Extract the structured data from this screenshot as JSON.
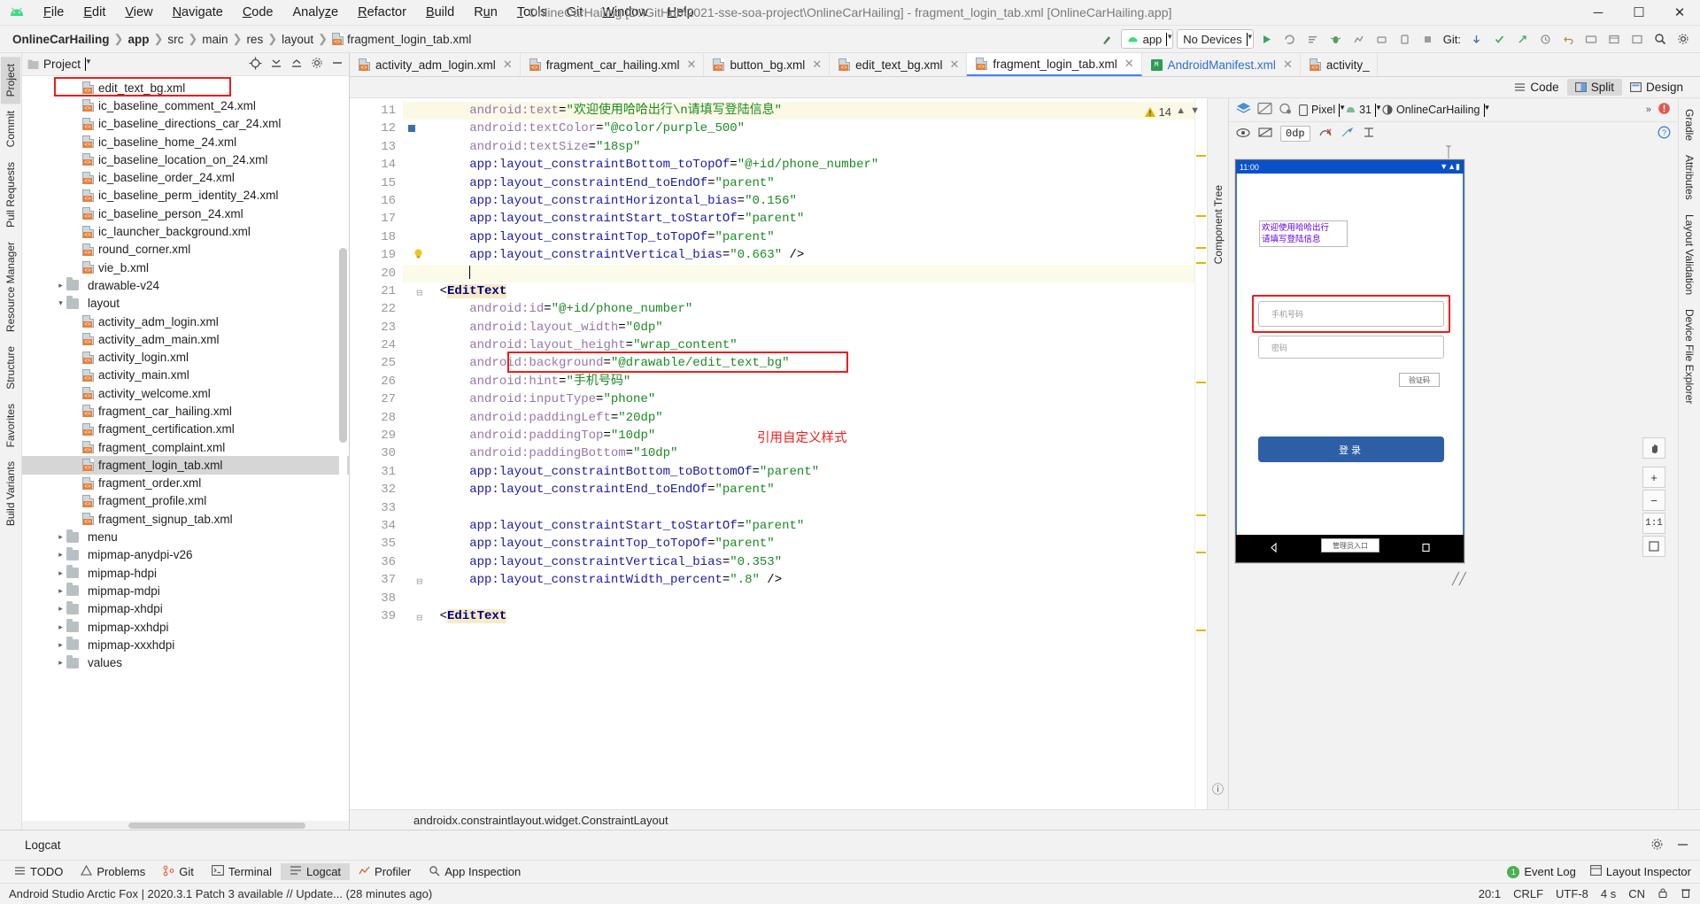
{
  "window": {
    "title": "OnlineCarHailing [D:\\GitHub\\2021-sse-soa-project\\OnlineCarHailing] - fragment_login_tab.xml [OnlineCarHailing.app]",
    "minimize": "—",
    "maximize": "❐",
    "close": "✕"
  },
  "menu": [
    "File",
    "Edit",
    "View",
    "Navigate",
    "Code",
    "Analyze",
    "Refactor",
    "Build",
    "Run",
    "Tools",
    "Git",
    "Window",
    "Help"
  ],
  "breadcrumb": [
    "OnlineCarHailing",
    "app",
    "src",
    "main",
    "res",
    "layout",
    "fragment_login_tab.xml"
  ],
  "toolbar": {
    "module_selector": "app",
    "device_selector": "No Devices",
    "git_label": "Git:"
  },
  "project_panel": {
    "title": "Project",
    "tree": [
      {
        "label": "edit_text_bg.xml",
        "type": "file",
        "indent": 3,
        "highlight": true
      },
      {
        "label": "ic_baseline_comment_24.xml",
        "type": "file",
        "indent": 3
      },
      {
        "label": "ic_baseline_directions_car_24.xml",
        "type": "file",
        "indent": 3
      },
      {
        "label": "ic_baseline_home_24.xml",
        "type": "file",
        "indent": 3
      },
      {
        "label": "ic_baseline_location_on_24.xml",
        "type": "file",
        "indent": 3
      },
      {
        "label": "ic_baseline_order_24.xml",
        "type": "file",
        "indent": 3
      },
      {
        "label": "ic_baseline_perm_identity_24.xml",
        "type": "file",
        "indent": 3
      },
      {
        "label": "ic_baseline_person_24.xml",
        "type": "file",
        "indent": 3
      },
      {
        "label": "ic_launcher_background.xml",
        "type": "file",
        "indent": 3
      },
      {
        "label": "round_corner.xml",
        "type": "file",
        "indent": 3
      },
      {
        "label": "vie_b.xml",
        "type": "file",
        "indent": 3
      },
      {
        "label": "drawable-v24",
        "type": "folder",
        "indent": 2,
        "arrow": "collapsed"
      },
      {
        "label": "layout",
        "type": "folder",
        "indent": 2,
        "arrow": "expanded"
      },
      {
        "label": "activity_adm_login.xml",
        "type": "file",
        "indent": 3
      },
      {
        "label": "activity_adm_main.xml",
        "type": "file",
        "indent": 3
      },
      {
        "label": "activity_login.xml",
        "type": "file",
        "indent": 3
      },
      {
        "label": "activity_main.xml",
        "type": "file",
        "indent": 3
      },
      {
        "label": "activity_welcome.xml",
        "type": "file",
        "indent": 3
      },
      {
        "label": "fragment_car_hailing.xml",
        "type": "file",
        "indent": 3
      },
      {
        "label": "fragment_certification.xml",
        "type": "file",
        "indent": 3
      },
      {
        "label": "fragment_complaint.xml",
        "type": "file",
        "indent": 3
      },
      {
        "label": "fragment_login_tab.xml",
        "type": "file",
        "indent": 3,
        "selected": true
      },
      {
        "label": "fragment_order.xml",
        "type": "file",
        "indent": 3
      },
      {
        "label": "fragment_profile.xml",
        "type": "file",
        "indent": 3
      },
      {
        "label": "fragment_signup_tab.xml",
        "type": "file",
        "indent": 3
      },
      {
        "label": "menu",
        "type": "folder",
        "indent": 2,
        "arrow": "collapsed"
      },
      {
        "label": "mipmap-anydpi-v26",
        "type": "folder",
        "indent": 2,
        "arrow": "collapsed"
      },
      {
        "label": "mipmap-hdpi",
        "type": "folder",
        "indent": 2,
        "arrow": "collapsed"
      },
      {
        "label": "mipmap-mdpi",
        "type": "folder",
        "indent": 2,
        "arrow": "collapsed"
      },
      {
        "label": "mipmap-xhdpi",
        "type": "folder",
        "indent": 2,
        "arrow": "collapsed"
      },
      {
        "label": "mipmap-xxhdpi",
        "type": "folder",
        "indent": 2,
        "arrow": "collapsed"
      },
      {
        "label": "mipmap-xxxhdpi",
        "type": "folder",
        "indent": 2,
        "arrow": "collapsed"
      },
      {
        "label": "values",
        "type": "folder",
        "indent": 2,
        "arrow": "collapsed"
      }
    ]
  },
  "left_rail": [
    "Project",
    "Commit",
    "Pull Requests",
    "Resource Manager",
    "Structure",
    "Favorites",
    "Build Variants"
  ],
  "right_rail": [
    "Gradle",
    "Attributes",
    "Layout Validation",
    "Device File Explorer"
  ],
  "editor_tabs": [
    {
      "label": "activity_adm_login.xml",
      "icon": "xml",
      "active": false
    },
    {
      "label": "fragment_car_hailing.xml",
      "icon": "xml",
      "active": false
    },
    {
      "label": "button_bg.xml",
      "icon": "xml",
      "active": false
    },
    {
      "label": "edit_text_bg.xml",
      "icon": "xml",
      "active": false
    },
    {
      "label": "fragment_login_tab.xml",
      "icon": "xml",
      "active": true
    },
    {
      "label": "AndroidManifest.xml",
      "icon": "manifest",
      "active": false
    },
    {
      "label": "activity_",
      "icon": "xml",
      "active": false
    }
  ],
  "view_modes": [
    {
      "label": "Code",
      "selected": false
    },
    {
      "label": "Split",
      "selected": true
    },
    {
      "label": "Design",
      "selected": false
    }
  ],
  "editor": {
    "warning_count": "14",
    "first_line": 11,
    "lines": [
      {
        "n": 11,
        "segments": [
          {
            "t": "android:text",
            "c": "attr"
          },
          {
            "t": "=",
            "c": "pl"
          },
          {
            "t": "\"欢迎使用哈哈出行\\n请填写登陆信息\"",
            "c": "str"
          }
        ],
        "indent": 2,
        "highlight": true
      },
      {
        "n": 12,
        "segments": [
          {
            "t": "android:textColor",
            "c": "attr"
          },
          {
            "t": "=",
            "c": "pl"
          },
          {
            "t": "\"@color/purple_500\"",
            "c": "str"
          }
        ],
        "indent": 2,
        "mark": true
      },
      {
        "n": 13,
        "segments": [
          {
            "t": "android:textSize",
            "c": "attr"
          },
          {
            "t": "=",
            "c": "pl"
          },
          {
            "t": "\"18sp\"",
            "c": "str"
          }
        ],
        "indent": 2
      },
      {
        "n": 14,
        "segments": [
          {
            "t": "app:layout_constraintBottom_toTopOf",
            "c": "attr2"
          },
          {
            "t": "=",
            "c": "pl"
          },
          {
            "t": "\"@+id/phone_number\"",
            "c": "str"
          }
        ],
        "indent": 2
      },
      {
        "n": 15,
        "segments": [
          {
            "t": "app:layout_constraintEnd_toEndOf",
            "c": "attr2"
          },
          {
            "t": "=",
            "c": "pl"
          },
          {
            "t": "\"parent\"",
            "c": "str"
          }
        ],
        "indent": 2
      },
      {
        "n": 16,
        "segments": [
          {
            "t": "app:layout_constraintHorizontal_bias",
            "c": "attr2"
          },
          {
            "t": "=",
            "c": "pl"
          },
          {
            "t": "\"0.156\"",
            "c": "str"
          }
        ],
        "indent": 2
      },
      {
        "n": 17,
        "segments": [
          {
            "t": "app:layout_constraintStart_toStartOf",
            "c": "attr2"
          },
          {
            "t": "=",
            "c": "pl"
          },
          {
            "t": "\"parent\"",
            "c": "str"
          }
        ],
        "indent": 2
      },
      {
        "n": 18,
        "segments": [
          {
            "t": "app:layout_constraintTop_toTopOf",
            "c": "attr2"
          },
          {
            "t": "=",
            "c": "pl"
          },
          {
            "t": "\"parent\"",
            "c": "str"
          }
        ],
        "indent": 2
      },
      {
        "n": 19,
        "segments": [
          {
            "t": "app:layout_constraintVertical_bias",
            "c": "attr2"
          },
          {
            "t": "=",
            "c": "pl"
          },
          {
            "t": "\"0.663\"",
            "c": "str"
          },
          {
            "t": " />",
            "c": "pl"
          }
        ],
        "indent": 2,
        "bulb": true
      },
      {
        "n": 20,
        "segments": [],
        "indent": 2,
        "caretline": true,
        "caret": true
      },
      {
        "n": 21,
        "segments": [
          {
            "t": "<",
            "c": "pl"
          },
          {
            "t": "EditText",
            "c": "tag"
          }
        ],
        "indent": 1,
        "fold": true
      },
      {
        "n": 22,
        "segments": [
          {
            "t": "android:id",
            "c": "attr"
          },
          {
            "t": "=",
            "c": "pl"
          },
          {
            "t": "\"@+id/phone_number\"",
            "c": "str"
          }
        ],
        "indent": 2
      },
      {
        "n": 23,
        "segments": [
          {
            "t": "android:layout_width",
            "c": "attr"
          },
          {
            "t": "=",
            "c": "pl"
          },
          {
            "t": "\"0dp\"",
            "c": "str"
          }
        ],
        "indent": 2
      },
      {
        "n": 24,
        "segments": [
          {
            "t": "android:layout_height",
            "c": "attr"
          },
          {
            "t": "=",
            "c": "pl"
          },
          {
            "t": "\"wrap_content\"",
            "c": "str"
          }
        ],
        "indent": 2
      },
      {
        "n": 25,
        "segments": [
          {
            "t": "android:background",
            "c": "attr"
          },
          {
            "t": "=",
            "c": "pl"
          },
          {
            "t": "\"@drawable/edit_text_bg\"",
            "c": "str"
          }
        ],
        "indent": 2,
        "boxed": true
      },
      {
        "n": 26,
        "segments": [
          {
            "t": "android:hint",
            "c": "attr"
          },
          {
            "t": "=",
            "c": "pl"
          },
          {
            "t": "\"手机号码\"",
            "c": "str"
          }
        ],
        "indent": 2
      },
      {
        "n": 27,
        "segments": [
          {
            "t": "android:inputType",
            "c": "attr"
          },
          {
            "t": "=",
            "c": "pl"
          },
          {
            "t": "\"phone\"",
            "c": "str"
          }
        ],
        "indent": 2
      },
      {
        "n": 28,
        "segments": [
          {
            "t": "android:paddingLeft",
            "c": "attr"
          },
          {
            "t": "=",
            "c": "pl"
          },
          {
            "t": "\"20dp\"",
            "c": "str"
          }
        ],
        "indent": 2
      },
      {
        "n": 29,
        "segments": [
          {
            "t": "android:paddingTop",
            "c": "attr"
          },
          {
            "t": "=",
            "c": "pl"
          },
          {
            "t": "\"10dp\"",
            "c": "str"
          }
        ],
        "indent": 2
      },
      {
        "n": 30,
        "segments": [
          {
            "t": "android:paddingBottom",
            "c": "attr"
          },
          {
            "t": "=",
            "c": "pl"
          },
          {
            "t": "\"10dp\"",
            "c": "str"
          }
        ],
        "indent": 2
      },
      {
        "n": 31,
        "segments": [
          {
            "t": "app:layout_constraintBottom_toBottomOf",
            "c": "attr2"
          },
          {
            "t": "=",
            "c": "pl"
          },
          {
            "t": "\"parent\"",
            "c": "str"
          }
        ],
        "indent": 2
      },
      {
        "n": 32,
        "segments": [
          {
            "t": "app:layout_constraintEnd_toEndOf",
            "c": "attr2"
          },
          {
            "t": "=",
            "c": "pl"
          },
          {
            "t": "\"parent\"",
            "c": "str"
          }
        ],
        "indent": 2
      },
      {
        "n": 33,
        "segments": [],
        "indent": 2
      },
      {
        "n": 34,
        "segments": [
          {
            "t": "app:layout_constraintStart_toStartOf",
            "c": "attr2"
          },
          {
            "t": "=",
            "c": "pl"
          },
          {
            "t": "\"parent\"",
            "c": "str"
          }
        ],
        "indent": 2
      },
      {
        "n": 35,
        "segments": [
          {
            "t": "app:layout_constraintTop_toTopOf",
            "c": "attr2"
          },
          {
            "t": "=",
            "c": "pl"
          },
          {
            "t": "\"parent\"",
            "c": "str"
          }
        ],
        "indent": 2
      },
      {
        "n": 36,
        "segments": [
          {
            "t": "app:layout_constraintVertical_bias",
            "c": "attr2"
          },
          {
            "t": "=",
            "c": "pl"
          },
          {
            "t": "\"0.353\"",
            "c": "str"
          }
        ],
        "indent": 2
      },
      {
        "n": 37,
        "segments": [
          {
            "t": "app:layout_constraintWidth_percent",
            "c": "attr2"
          },
          {
            "t": "=",
            "c": "pl"
          },
          {
            "t": "\".8\"",
            "c": "str"
          },
          {
            "t": " />",
            "c": "pl"
          }
        ],
        "indent": 2,
        "fold": true
      },
      {
        "n": 38,
        "segments": [],
        "indent": 2
      },
      {
        "n": 39,
        "segments": [
          {
            "t": "<",
            "c": "pl"
          },
          {
            "t": "EditText",
            "c": "tag"
          }
        ],
        "indent": 1,
        "fold": true
      }
    ],
    "annotation": "引用自定义样式",
    "status_text": "androidx.constraintlayout.widget.ConstraintLayout"
  },
  "preview": {
    "device": "Pixel",
    "api_level": "31",
    "theme": "OnlineCarHailing",
    "dp_value": "0dp",
    "phone": {
      "clock": "11:00",
      "welcome": "欢迎使用哈哈出行\n请填写登陆信息",
      "phone_hint": "手机号码",
      "password_hint": "密码",
      "captcha": "验证码",
      "login_button": "登录",
      "admin_entry": "管理员入口"
    },
    "zoom_ratio": "1:1"
  },
  "bottom": {
    "logcat_title": "Logcat",
    "tools": [
      {
        "label": "TODO",
        "icon": "list-icon",
        "selected": false
      },
      {
        "label": "Problems",
        "icon": "warning-icon",
        "selected": false
      },
      {
        "label": "Git",
        "icon": "git-icon",
        "selected": false
      },
      {
        "label": "Terminal",
        "icon": "terminal-icon",
        "selected": false
      },
      {
        "label": "Logcat",
        "icon": "logcat-icon",
        "selected": true
      },
      {
        "label": "Profiler",
        "icon": "profiler-icon",
        "selected": false
      },
      {
        "label": "App Inspection",
        "icon": "inspection-icon",
        "selected": false
      }
    ],
    "right_items": [
      {
        "label": "Event Log",
        "badge": "1"
      },
      {
        "label": "Layout Inspector",
        "badge": ""
      }
    ]
  },
  "footer": {
    "message": "Android Studio Arctic Fox | 2020.3.1 Patch 3 available // Update... (28 minutes ago)",
    "caret_pos": "20:1",
    "line_sep": "CRLF",
    "encoding": "UTF-8",
    "indent": "4 s",
    "lang": "CN"
  },
  "colors": {
    "accent_blue": "#4285f4",
    "annotation_red": "#ee1c1c",
    "purple_500": "#6200ee",
    "string_green": "#1a8a22",
    "attr_purple": "#9876aa"
  }
}
